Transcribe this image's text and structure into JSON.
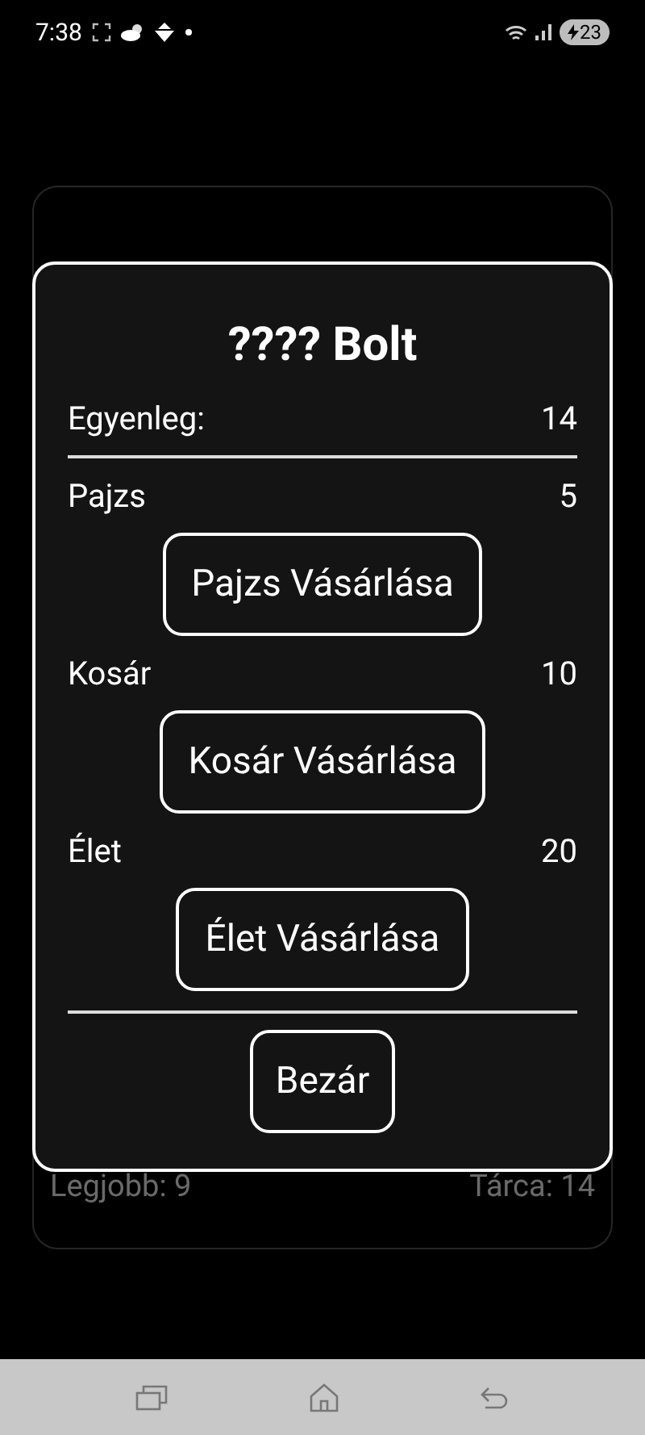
{
  "status_bar": {
    "time": "7:38",
    "battery": "23"
  },
  "background_card": {
    "best": "Legjobb: 9",
    "wallet": "Tárca: 14"
  },
  "dialog": {
    "title": "???? Bolt",
    "balance_label": "Egyenleg:",
    "balance_value": "14",
    "items": [
      {
        "name": "Pajzs",
        "price": "5",
        "button": "Pajzs Vásárlása"
      },
      {
        "name": "Kosár",
        "price": "10",
        "button": "Kosár Vásárlása"
      },
      {
        "name": "Élet",
        "price": "20",
        "button": "Élet Vásárlása"
      }
    ],
    "close_button": "Bezár"
  }
}
